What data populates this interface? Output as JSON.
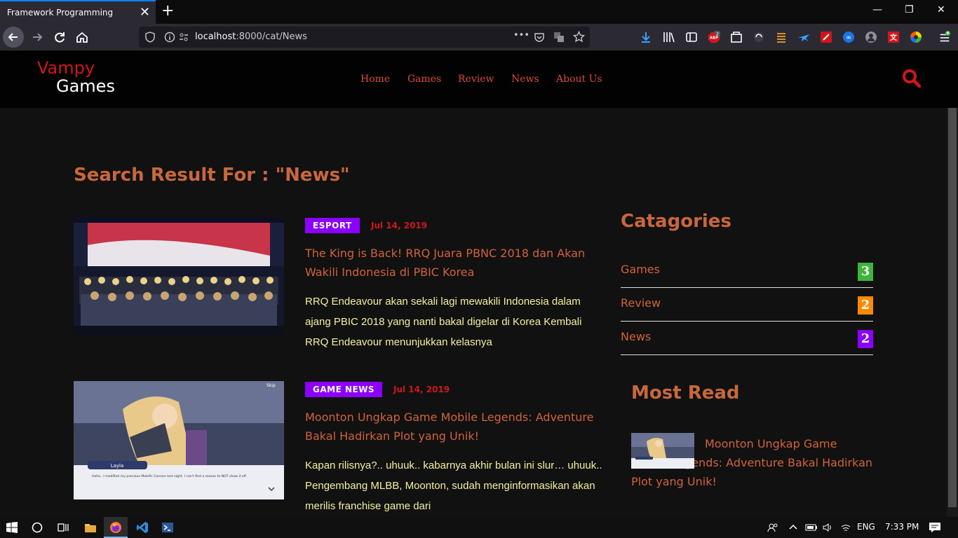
{
  "browser": {
    "tab_title": "Framework Programming",
    "tab_close": "✕",
    "new_tab": "+",
    "url_host": "localhost",
    "url_path": ":8000/cat/News",
    "more_actions": "•••",
    "window_minimize": "—",
    "window_restore": "❐",
    "window_close": "✕"
  },
  "site": {
    "logo_top": "Vampy",
    "logo_bottom": "Games",
    "menu": [
      "Home",
      "Games",
      "Review",
      "News",
      "About Us"
    ]
  },
  "search": {
    "heading": "Search Result For : \"News\""
  },
  "posts": [
    {
      "category": "ESPORT",
      "date": "Jul 14, 2019",
      "title": "The King is Back! RRQ Juara PBNC 2018 dan Akan Wakili Indonesia di PBIC Korea",
      "excerpt": "RRQ Endeavour akan sekali lagi mewakili Indonesia dalam ajang PBIC 2018 yang nanti bakal digelar di Korea Kembali RRQ Endeavour menunjukkan kelasnya"
    },
    {
      "category": "GAME NEWS",
      "date": "Jul 14, 2019",
      "title": "Moonton Ungkap Game Mobile Legends: Adventure Bakal Hadirkan Plot yang Unik!",
      "excerpt": "Kapan rilisnya?.. uhuuk.. kabarnya akhir bulan ini slur… uhuuk.. Pengembang MLBB, Moonton, sudah menginformasikan akan merilis franchise game dari",
      "thumb_caption_name": "Layla",
      "thumb_caption_text": "Haha...I modified my precious Malefic Cannon last night. I can't find a reason to NOT show it off.",
      "thumb_skip": "Skip"
    }
  ],
  "categories": {
    "heading": "Catagories",
    "items": [
      {
        "label": "Games",
        "count": "3",
        "color": "#3fb43c"
      },
      {
        "label": "Review",
        "count": "2",
        "color": "#ff8a00"
      },
      {
        "label": "News",
        "count": "2",
        "color": "#8b00ff"
      }
    ]
  },
  "most_read": {
    "heading": "Most Read",
    "title": "Moonton Ungkap Game Mobile Legends: Adventure Bakal Hadirkan Plot yang Unik!"
  },
  "taskbar": {
    "language": "ENG",
    "time": "7:33 PM"
  },
  "colors": {
    "accent": "#d1161b",
    "heading": "#c9673d",
    "link": "#d1623c",
    "badge": "#8b00ff",
    "excerpt": "#f5f0a0"
  }
}
